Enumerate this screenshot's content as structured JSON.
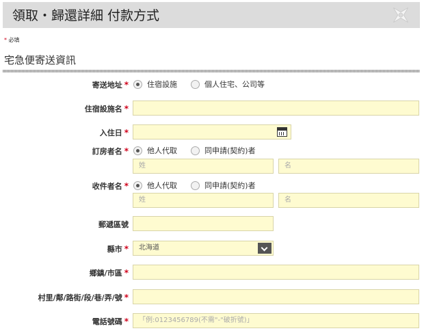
{
  "header": {
    "title": "領取・歸還詳細 付款方式"
  },
  "required_note": {
    "star": "*",
    "text": "必填"
  },
  "section": {
    "title": "宅急便寄送資訊"
  },
  "form": {
    "required_star": "*",
    "address_type": {
      "label": "寄送地址",
      "options": [
        "住宿設施",
        "個人住宅、公司等"
      ],
      "selected": "住宿設施"
    },
    "facility_name": {
      "label": "住宿設施名",
      "value": ""
    },
    "checkin_date": {
      "label": "入住日",
      "value": ""
    },
    "booker_name": {
      "label": "訂房者名",
      "options": [
        "他人代取",
        "同申請(契約)者"
      ],
      "selected": "他人代取",
      "last_placeholder": "姓",
      "first_placeholder": "名"
    },
    "recipient_name": {
      "label": "收件者名",
      "options": [
        "他人代取",
        "同申請(契約)者"
      ],
      "selected": "他人代取",
      "last_placeholder": "姓",
      "first_placeholder": "名"
    },
    "postal_code": {
      "label": "郵遞區號",
      "value": ""
    },
    "city": {
      "label": "縣市",
      "selected": "北海道"
    },
    "district": {
      "label": "鄉鎮/市區",
      "value": ""
    },
    "street": {
      "label": "村里/鄰/路街/段/巷/弄/號",
      "value": ""
    },
    "phone": {
      "label": "電話號碼",
      "placeholder": "「例:0123456789(不需\"-\"破折號)」"
    }
  },
  "colors": {
    "field_bg": "#fefbd0",
    "required": "#d0021b",
    "header_bg": "#dcdcdc"
  }
}
